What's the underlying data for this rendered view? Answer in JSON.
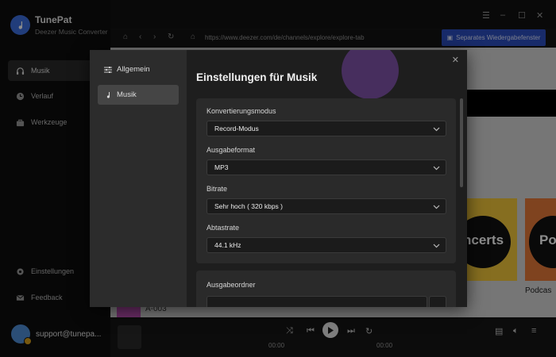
{
  "app": {
    "title": "TunePat",
    "subtitle": "Deezer Music Converter"
  },
  "sidebar": {
    "items": [
      {
        "label": "Musik",
        "icon": "headphones-icon"
      },
      {
        "label": "Verlauf",
        "icon": "clock-icon"
      },
      {
        "label": "Werkzeuge",
        "icon": "toolbox-icon"
      }
    ],
    "bottom": [
      {
        "label": "Einstellungen",
        "icon": "gear-icon"
      },
      {
        "label": "Feedback",
        "icon": "mail-icon"
      }
    ],
    "user": "support@tunepa..."
  },
  "browser": {
    "url": "https://www.deezer.com/de/channels/explore/explore-tab",
    "separate_window_label": "Separates Wiedergabefenster"
  },
  "background": {
    "tile1_text": "ncerts",
    "tile2_text": "Po",
    "podcast_label": "Podcas",
    "track_label": "A-003"
  },
  "player": {
    "time_current": "00:00",
    "time_total": "00:00"
  },
  "settings": {
    "nav": [
      {
        "label": "Allgemein",
        "icon": "sliders-icon"
      },
      {
        "label": "Musik",
        "icon": "music-note-icon"
      }
    ],
    "title": "Einstellungen für Musik",
    "fields": [
      {
        "label": "Konvertierungsmodus",
        "value": "Record-Modus"
      },
      {
        "label": "Ausgabeformat",
        "value": "MP3"
      },
      {
        "label": "Bitrate",
        "value": "Sehr hoch ( 320 kbps )"
      },
      {
        "label": "Abtastrate",
        "value": "44.1 kHz"
      }
    ],
    "output_folder_label": "Ausgabeordner"
  },
  "colors": {
    "accent": "#2d4fc2",
    "deco": "#6a3d93"
  }
}
